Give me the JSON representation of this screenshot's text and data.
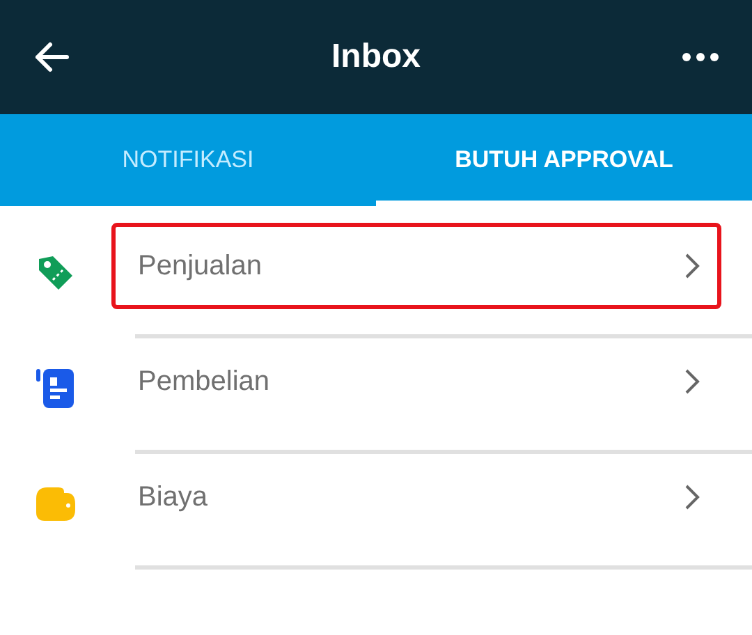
{
  "header": {
    "title": "Inbox"
  },
  "tabs": [
    {
      "label": "NOTIFIKASI",
      "selected": false
    },
    {
      "label": "BUTUH APPROVAL",
      "selected": true
    }
  ],
  "items": [
    {
      "label": "Penjualan",
      "kind": "tag",
      "color": "#109d58",
      "highlighted": true
    },
    {
      "label": "Pembelian",
      "kind": "document",
      "color": "#1a5ae8",
      "highlighted": false
    },
    {
      "label": "Biaya",
      "kind": "wallet",
      "color": "#fbbc05",
      "highlighted": false
    }
  ]
}
